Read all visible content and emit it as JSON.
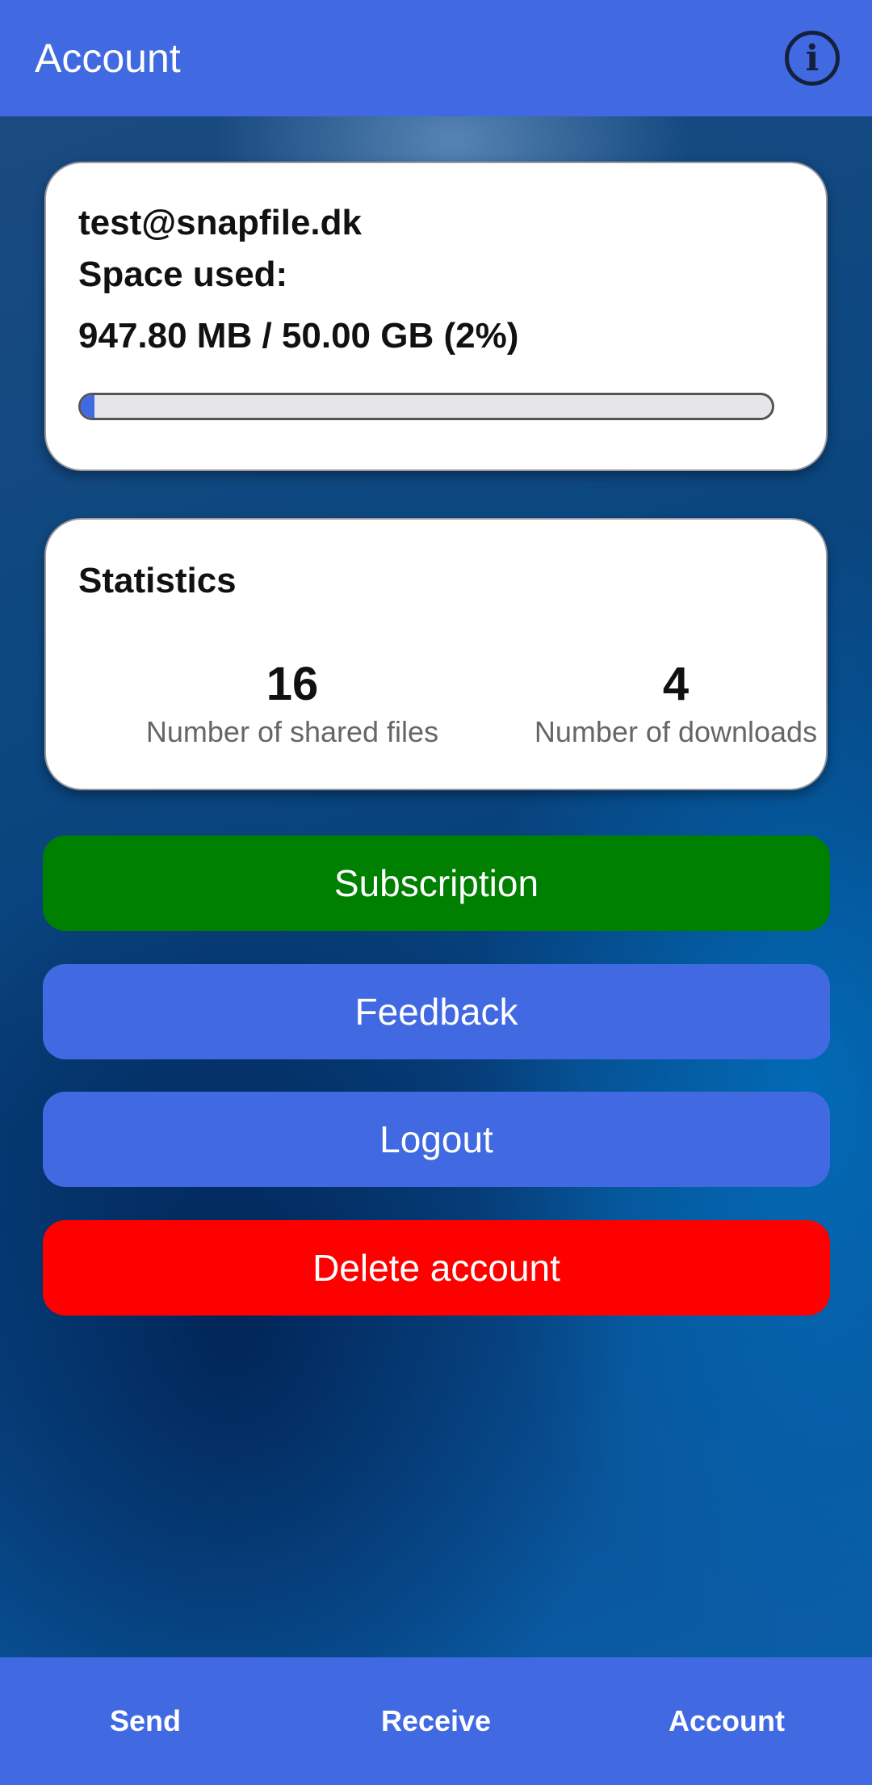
{
  "app_bar": {
    "title": "Account",
    "info_icon": "info-circle-icon",
    "info_glyph": "i"
  },
  "colors": {
    "primary": "#4169e1",
    "subscription": "#008000",
    "delete": "#ff0000"
  },
  "account": {
    "email": "test@snapfile.dk",
    "space_label": "Space used:",
    "space_value": "947.80 MB / 50.00 GB (2%)",
    "usage_fraction": 0.02
  },
  "statistics": {
    "title": "Statistics",
    "shared_files_count": "16",
    "shared_files_label": "Number of shared files",
    "downloads_count": "4",
    "downloads_label": "Number of downloads"
  },
  "buttons": {
    "subscription": "Subscription",
    "feedback": "Feedback",
    "logout": "Logout",
    "delete_account": "Delete account"
  },
  "bottom_nav": {
    "send": "Send",
    "receive": "Receive",
    "account": "Account"
  }
}
